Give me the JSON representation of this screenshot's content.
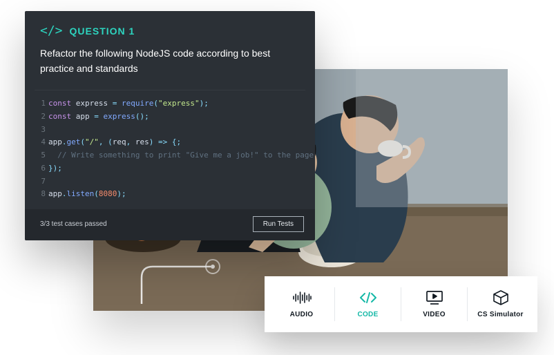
{
  "codeCard": {
    "questionLabel": "QUESTION 1",
    "questionPrompt": "Refactor the following NodeJS code according to best practice and standards",
    "code": {
      "lines": [
        {
          "n": "1",
          "t": [
            [
              "kw",
              "const"
            ],
            [
              "plain",
              " "
            ],
            [
              "id",
              "express"
            ],
            [
              "plain",
              " "
            ],
            [
              "op",
              "="
            ],
            [
              "plain",
              " "
            ],
            [
              "fn",
              "require"
            ],
            [
              "op",
              "("
            ],
            [
              "str",
              "\"express\""
            ],
            [
              "op",
              ")"
            ],
            [
              "op",
              ";"
            ]
          ]
        },
        {
          "n": "2",
          "t": [
            [
              "kw",
              "const"
            ],
            [
              "plain",
              " "
            ],
            [
              "id",
              "app"
            ],
            [
              "plain",
              " "
            ],
            [
              "op",
              "="
            ],
            [
              "plain",
              " "
            ],
            [
              "fn",
              "express"
            ],
            [
              "op",
              "()"
            ],
            [
              "op",
              ";"
            ]
          ]
        },
        {
          "n": "3",
          "t": []
        },
        {
          "n": "4",
          "t": [
            [
              "id",
              "app"
            ],
            [
              "op",
              "."
            ],
            [
              "fn",
              "get"
            ],
            [
              "op",
              "("
            ],
            [
              "str",
              "\"/\""
            ],
            [
              "op",
              ","
            ],
            [
              "plain",
              " "
            ],
            [
              "op",
              "("
            ],
            [
              "id",
              "req"
            ],
            [
              "op",
              ","
            ],
            [
              "plain",
              " "
            ],
            [
              "id",
              "res"
            ],
            [
              "op",
              ")"
            ],
            [
              "plain",
              " "
            ],
            [
              "op",
              "=>"
            ],
            [
              "plain",
              " "
            ],
            [
              "op",
              "{"
            ],
            [
              "op",
              ";"
            ]
          ]
        },
        {
          "n": "5",
          "t": [
            [
              "plain",
              "  "
            ],
            [
              "cmt",
              "// Write something to print \"Give me a job!\" to the page"
            ]
          ]
        },
        {
          "n": "6",
          "t": [
            [
              "op",
              "}"
            ],
            [
              "op",
              ")"
            ],
            [
              "op",
              ";"
            ]
          ]
        },
        {
          "n": "7",
          "t": []
        },
        {
          "n": "8",
          "t": [
            [
              "id",
              "app"
            ],
            [
              "op",
              "."
            ],
            [
              "fn",
              "listen"
            ],
            [
              "op",
              "("
            ],
            [
              "num",
              "8080"
            ],
            [
              "op",
              ")"
            ],
            [
              "op",
              ";"
            ]
          ]
        }
      ]
    },
    "footer": {
      "testStatus": "3/3 test cases passed",
      "runButton": "Run Tests"
    }
  },
  "toolbar": {
    "items": [
      {
        "icon": "audio-icon",
        "label": "AUDIO",
        "active": false
      },
      {
        "icon": "code-icon",
        "label": "CODE",
        "active": true
      },
      {
        "icon": "video-icon",
        "label": "VIDEO",
        "active": false
      },
      {
        "icon": "cube-icon",
        "label": "CS Simulator",
        "active": false
      }
    ]
  }
}
